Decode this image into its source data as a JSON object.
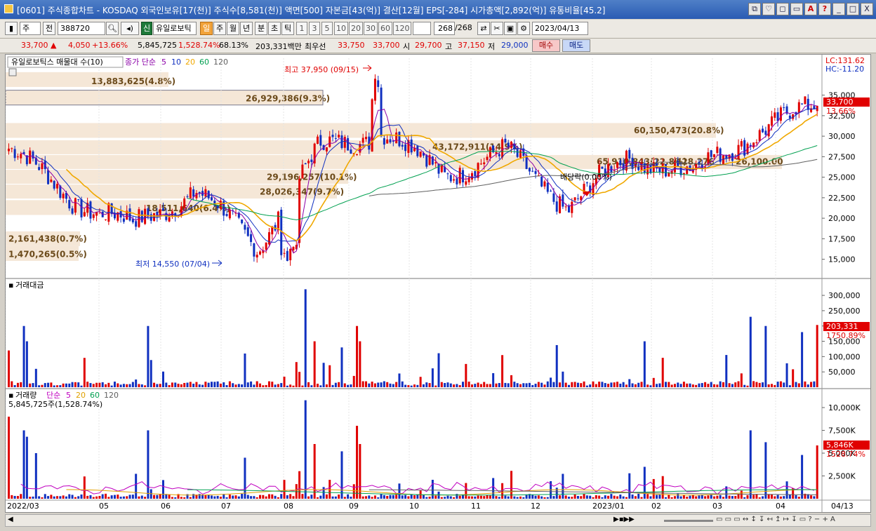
{
  "window": {
    "title": "[0601] 주식종합차트 - KOSDAQ 외국인보유[17(천)] 주식수[8,581(천)] 액면[500] 자본금[43(억)] 결산[12월] EPS[-284] 시가총액[2,892(억)] 유통비율[45.2]",
    "buttons": [
      "⧉",
      "♡",
      "◻",
      "▭",
      "A",
      "?",
      "_",
      "□",
      "X"
    ]
  },
  "toolbar": {
    "kind": "주",
    "prev_label": "전",
    "code": "388720",
    "stock_name": "유일로보틱",
    "new_badge": "신",
    "periods": [
      "일",
      "주",
      "월",
      "년",
      "분",
      "초",
      "틱"
    ],
    "active_period": "일",
    "minutes": [
      "1",
      "3",
      "5",
      "10",
      "20",
      "30",
      "60",
      "120"
    ],
    "count": "268",
    "count_total": "/268",
    "date": "2023/04/13"
  },
  "quote": {
    "price": "33,700",
    "arrow": "▲",
    "change": "4,050",
    "change_pct": "+13.66%",
    "volume": "5,845,725",
    "volume_pct": "1,528.74%",
    "turnover": "68.13%",
    "amount": "203,331백만",
    "best_label": "최우선",
    "best_ask": "33,750",
    "best_bid": "33,700",
    "open_label": "시",
    "open": "29,700",
    "high_label": "고",
    "high": "37,150",
    "low_label": "저",
    "low": "29,000",
    "buy_label": "매수",
    "sell_label": "매도"
  },
  "price_panel": {
    "legend_title": "유일로보틱스 매물대 수(10)",
    "ma_label": "종가 단순",
    "ma_periods": [
      "5",
      "10",
      "20",
      "60",
      "120"
    ],
    "ma_colors": [
      "#8b00a8",
      "#1030c0",
      "#f0a800",
      "#00a050",
      "#606060"
    ],
    "lc": "LC:131.62",
    "hc": "HC:-11.20",
    "current_price": "33,700",
    "current_pct": "13.66%",
    "high_marker": "최고 37,950 (09/15)",
    "low_marker": "최저 14,550 (07/04)",
    "dividend_marker": "배당락(0.00%)",
    "volume_profile": [
      "13,883,625(4.8%)",
      "26,929,386(9.3%)",
      "60,150,473(20.8%)",
      "43,172,911(14.9%)",
      "65,910,843(22.8%)",
      "29,196,257(10.1%)",
      "28,026,347(9.7%)",
      "18,511,640(6.4%)",
      "2,161,438(0.7%)",
      "1,470,265(0.5%)"
    ],
    "extra_price_label": "26,100.00",
    "extra_label_2": "428,276"
  },
  "amount_panel": {
    "title": "거래대금",
    "current": "203,331",
    "current_pct": "1750.89%"
  },
  "volume_panel": {
    "title": "거래량",
    "ma_label": "단순",
    "ma_periods": [
      "5",
      "20",
      "60",
      "120"
    ],
    "ma_colors": [
      "#c000c0",
      "#e0a000",
      "#00a050",
      "#606060"
    ],
    "summary": "5,845,725주(1,528.74%)",
    "current": "5,846K",
    "current_pct": "1528.74%"
  },
  "x_axis": {
    "labels": [
      "2022/03",
      "05",
      "06",
      "07",
      "08",
      "09",
      "10",
      "11",
      "12",
      "2023/01",
      "02",
      "03",
      "04"
    ],
    "end_label": "04/13"
  },
  "chart_data": {
    "type": "candlestick",
    "x_range": [
      "2022/03",
      "2023/04/13"
    ],
    "price_axis_ticks": [
      35000,
      32500,
      30000,
      27500,
      25000,
      22500,
      20000,
      17500,
      15000
    ],
    "price_range": [
      13000,
      39500
    ],
    "amount_axis_ticks": [
      300000,
      250000,
      200000,
      150000,
      100000,
      50000
    ],
    "volume_axis_ticks": [
      "10,000K",
      "7,500K",
      "5,000K",
      "2,500K"
    ],
    "monthly_close_approx": [
      {
        "month": "2022/03",
        "close": 28500
      },
      {
        "month": "2022/04",
        "close": 22500
      },
      {
        "month": "2022/05",
        "close": 19000
      },
      {
        "month": "2022/06",
        "close": 23500
      },
      {
        "month": "2022/07",
        "close": 16500
      },
      {
        "month": "2022/08",
        "close": 28500
      },
      {
        "month": "2022/09",
        "close": 30500
      },
      {
        "month": "2022/10",
        "close": 25500
      },
      {
        "month": "2022/11",
        "close": 28000
      },
      {
        "month": "2022/12",
        "close": 21500
      },
      {
        "month": "2023/01",
        "close": 27500
      },
      {
        "month": "2023/02",
        "close": 25500
      },
      {
        "month": "2023/03",
        "close": 30500
      },
      {
        "month": "2023/04",
        "close": 33700
      }
    ]
  }
}
